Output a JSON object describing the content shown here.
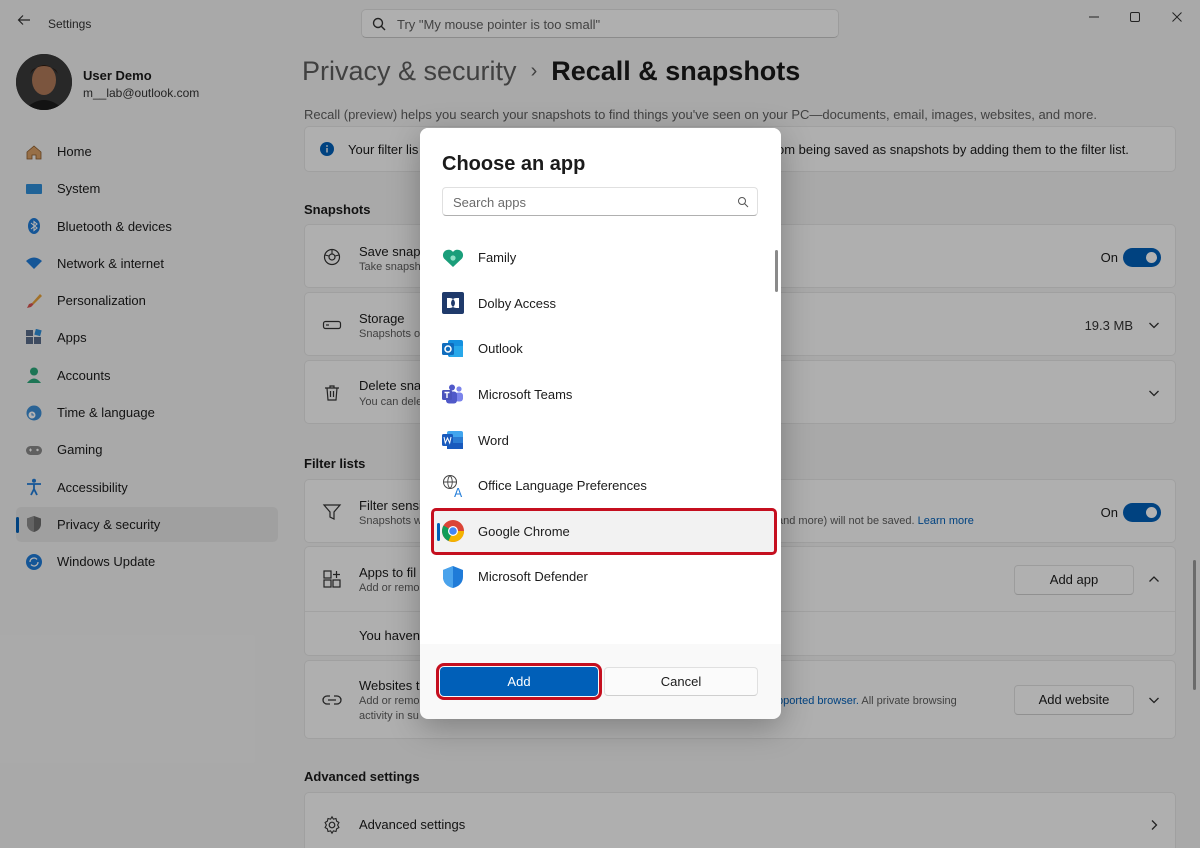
{
  "window": {
    "title": "Settings",
    "search_placeholder": "Try \"My mouse pointer is too small\""
  },
  "user": {
    "name": "User Demo",
    "email": "m__lab@outlook.com"
  },
  "sidebar": {
    "items": [
      {
        "label": "Home",
        "icon": "home-icon"
      },
      {
        "label": "System",
        "icon": "system-icon"
      },
      {
        "label": "Bluetooth & devices",
        "icon": "bluetooth-icon"
      },
      {
        "label": "Network & internet",
        "icon": "wifi-icon"
      },
      {
        "label": "Personalization",
        "icon": "brush-icon"
      },
      {
        "label": "Apps",
        "icon": "apps-icon"
      },
      {
        "label": "Accounts",
        "icon": "accounts-icon"
      },
      {
        "label": "Time & language",
        "icon": "clock-globe-icon"
      },
      {
        "label": "Gaming",
        "icon": "gamepad-icon"
      },
      {
        "label": "Accessibility",
        "icon": "accessibility-icon"
      },
      {
        "label": "Privacy & security",
        "icon": "shield-icon",
        "active": true
      },
      {
        "label": "Windows Update",
        "icon": "update-icon"
      }
    ]
  },
  "page": {
    "breadcrumb_parent": "Privacy & security",
    "breadcrumb_separator": "›",
    "breadcrumb_current": "Recall & snapshots",
    "description": "Recall (preview) helps you search your snapshots to find things you've seen on your PC—documents, email, images, websites, and more.",
    "info_left": "Your filter lis",
    "info_right": "om being saved as snapshots by adding them to the filter list.",
    "snapshots_section": "Snapshots",
    "save_snapshots_title": "Save snaps",
    "save_snapshots_sub": "Take snapsh",
    "save_snapshots_state": "On",
    "storage_title": "Storage",
    "storage_sub": "Snapshots o",
    "storage_value": "19.3 MB",
    "delete_title": "Delete sna",
    "delete_sub": "You can dele",
    "filter_section": "Filter lists",
    "filter_sensitive_title": "Filter sensi",
    "filter_sensitive_sub": "Snapshots w",
    "filter_sensitive_tail": "and more) will not be saved.",
    "learn_more": "Learn more",
    "filter_sensitive_state": "On",
    "apps_filter_title": "Apps to fil",
    "apps_filter_sub": "Add or remo",
    "add_app_label": "Add app",
    "no_apps_text": "You haven'",
    "websites_title": "Websites t",
    "websites_sub1": "Add or remo",
    "websites_sub2": "activity in su",
    "websites_link": "pported browser.",
    "websites_tail": "All private browsing",
    "add_website_label": "Add website",
    "advanced_section": "Advanced settings",
    "advanced_title": "Advanced settings"
  },
  "dialog": {
    "title": "Choose an app",
    "search_placeholder": "Search apps",
    "apps": [
      {
        "name": "Family",
        "icon": "family-heart-icon"
      },
      {
        "name": "Dolby Access",
        "icon": "dolby-icon"
      },
      {
        "name": "Outlook",
        "icon": "outlook-icon"
      },
      {
        "name": "Microsoft Teams",
        "icon": "teams-icon"
      },
      {
        "name": "Word",
        "icon": "word-icon"
      },
      {
        "name": "Office Language Preferences",
        "icon": "language-icon"
      },
      {
        "name": "Google Chrome",
        "icon": "chrome-icon",
        "selected": true
      },
      {
        "name": "Microsoft Defender",
        "icon": "defender-shield-icon"
      }
    ],
    "add_label": "Add",
    "cancel_label": "Cancel"
  },
  "colors": {
    "accent": "#005fb8",
    "highlight": "#c50f1f"
  }
}
